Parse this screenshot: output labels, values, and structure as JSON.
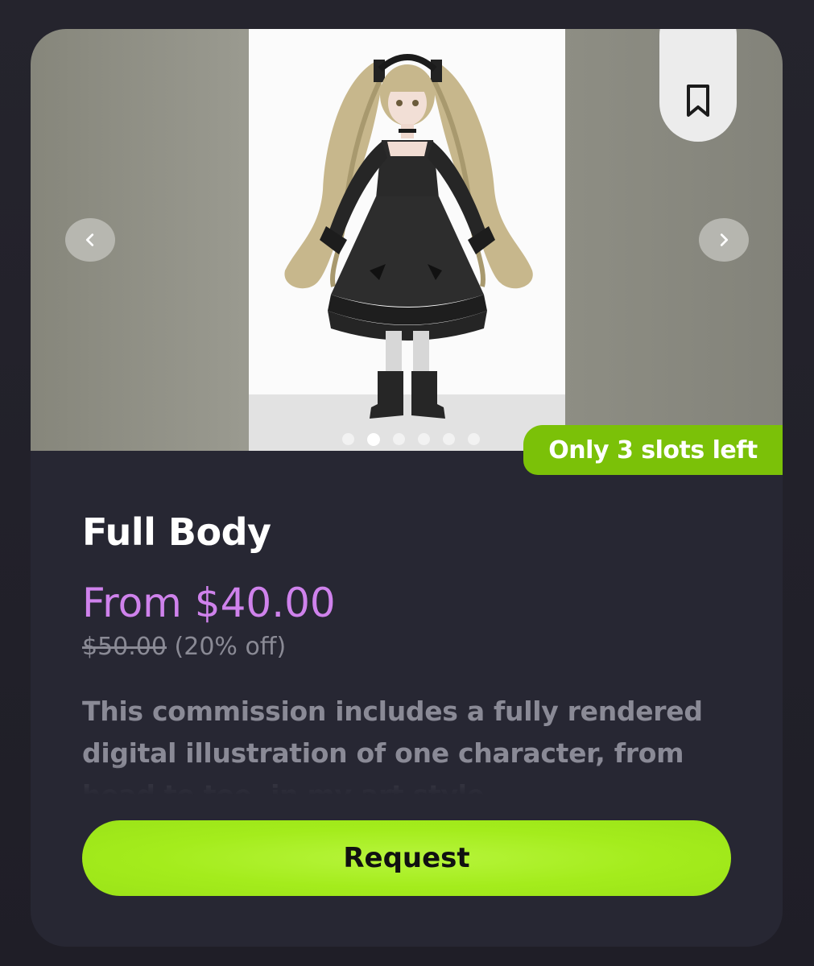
{
  "listing": {
    "title": "Full Body",
    "price": "From $40.00",
    "original_price": "$50.00",
    "discount": "(20% off)",
    "description": "This commission includes a fully rendered digital illustration of one character, from head to toe, in my art style.",
    "slots_badge": "Only 3 slots left",
    "request_label": "Request"
  },
  "gallery": {
    "image_count": 6,
    "active_index": 1,
    "image_alt": "Character in a black gothic lolita dress with long blonde twin tails",
    "prev_icon": "chevron-left-icon",
    "next_icon": "chevron-right-icon",
    "bookmark_icon": "bookmark-icon"
  },
  "colors": {
    "background": "#26252f",
    "card": "#272733",
    "price": "#cf82ec",
    "accent_green": "#a4ec1c",
    "badge_green": "#7bc108"
  }
}
